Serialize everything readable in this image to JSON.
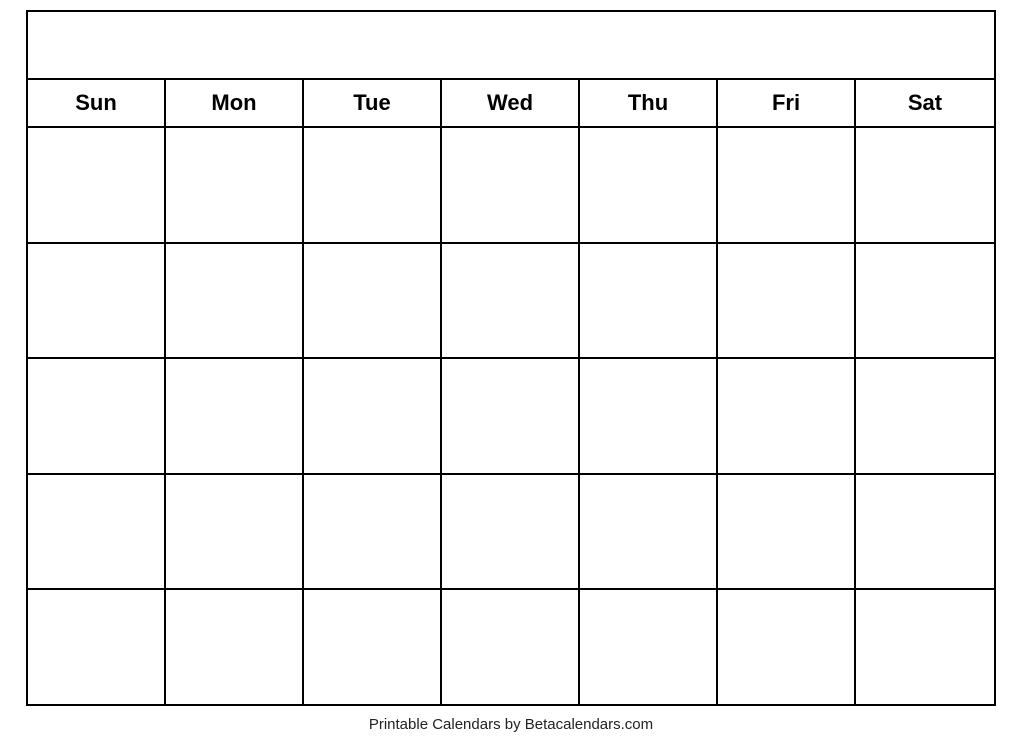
{
  "calendar": {
    "days": [
      "Sun",
      "Mon",
      "Tue",
      "Wed",
      "Thu",
      "Fri",
      "Sat"
    ],
    "rows": 5
  },
  "footer": {
    "text": "Printable Calendars by Betacalendars.com"
  }
}
